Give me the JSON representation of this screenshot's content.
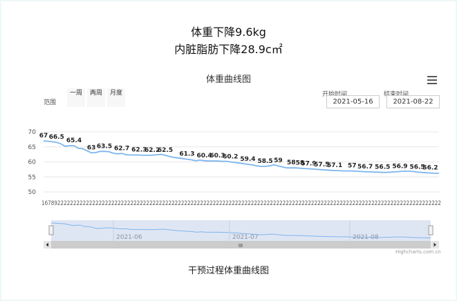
{
  "header": {
    "line1": "体重下降9.6kg",
    "line2": "内脏脂肪下降28.9c㎡"
  },
  "range_selector": {
    "label": "范围",
    "buttons": [
      "一周",
      "两周",
      "月度"
    ],
    "from_label": "开始时间",
    "from_value": "2021-05-16",
    "to_label": "结束时间",
    "to_value": "2021-08-22"
  },
  "navigator": {
    "labels": [
      "2021-06",
      "2021-07",
      "2021-08"
    ],
    "scroll_grip": "III"
  },
  "credits": "Highcharts.com.cn",
  "caption": "干预过程体重曲线图",
  "chart_data": {
    "type": "line",
    "title": "体重曲线图",
    "y_ticks": [
      50,
      55,
      60,
      65,
      70
    ],
    "ylim": [
      50,
      70
    ],
    "x_tick_text": "167892222222222222222222222222222222222222222222222222222222222222222222222222222222222222222222222222222222222222222222222222",
    "grid": true,
    "series": [
      {
        "color": "#7cb5ec",
        "values": [
          67.0,
          66.9,
          66.7,
          66.5,
          66.0,
          65.2,
          65.4,
          65.4,
          64.5,
          64.4,
          63.7,
          63.0,
          63.1,
          63.5,
          63.5,
          63.4,
          62.9,
          62.7,
          62.8,
          62.4,
          62.3,
          62.3,
          62.3,
          62.2,
          62.2,
          62.2,
          62.4,
          62.5,
          62.2,
          61.8,
          61.5,
          61.3,
          61.1,
          60.9,
          60.7,
          60.4,
          60.6,
          60.4,
          60.3,
          60.3,
          60.3,
          60.2,
          60.2,
          60.0,
          59.8,
          59.6,
          59.4,
          59.2,
          59.0,
          58.7,
          58.5,
          58.5,
          58.7,
          59.0,
          58.7,
          58.3,
          58.0,
          58.0,
          58.0,
          57.9,
          57.8,
          57.7,
          57.6,
          57.5,
          57.4,
          57.3,
          57.2,
          57.1,
          57.1,
          57.0,
          57.0,
          57.0,
          56.9,
          56.8,
          56.7,
          56.7,
          56.6,
          56.6,
          56.5,
          56.5,
          56.6,
          56.7,
          56.8,
          56.9,
          56.9,
          56.8,
          56.6,
          56.5,
          56.4,
          56.3,
          56.2,
          56.2
        ],
        "labels": [
          {
            "i": 0,
            "text": "67"
          },
          {
            "i": 3,
            "text": "66.5"
          },
          {
            "i": 7,
            "text": "65.4"
          },
          {
            "i": 11,
            "text": "63"
          },
          {
            "i": 14,
            "text": "63.5"
          },
          {
            "i": 18,
            "text": "62.7"
          },
          {
            "i": 22,
            "text": "62.3"
          },
          {
            "i": 25,
            "text": "62.2"
          },
          {
            "i": 28,
            "text": "62.5"
          },
          {
            "i": 33,
            "text": "61.3"
          },
          {
            "i": 37,
            "text": "60.4"
          },
          {
            "i": 40,
            "text": "60.3"
          },
          {
            "i": 43,
            "text": "60.2"
          },
          {
            "i": 47,
            "text": "59.4"
          },
          {
            "i": 51,
            "text": "58.5"
          },
          {
            "i": 54,
            "text": "59"
          },
          {
            "i": 57,
            "text": "58"
          },
          {
            "i": 59,
            "text": "58"
          },
          {
            "i": 61,
            "text": "57.9"
          },
          {
            "i": 64,
            "text": "57.5"
          },
          {
            "i": 67,
            "text": "57.1"
          },
          {
            "i": 71,
            "text": "57"
          },
          {
            "i": 74,
            "text": "56.7"
          },
          {
            "i": 78,
            "text": "56.5"
          },
          {
            "i": 82,
            "text": "56.9"
          },
          {
            "i": 86,
            "text": "56.5"
          },
          {
            "i": 89,
            "text": "56.2"
          }
        ]
      }
    ]
  }
}
